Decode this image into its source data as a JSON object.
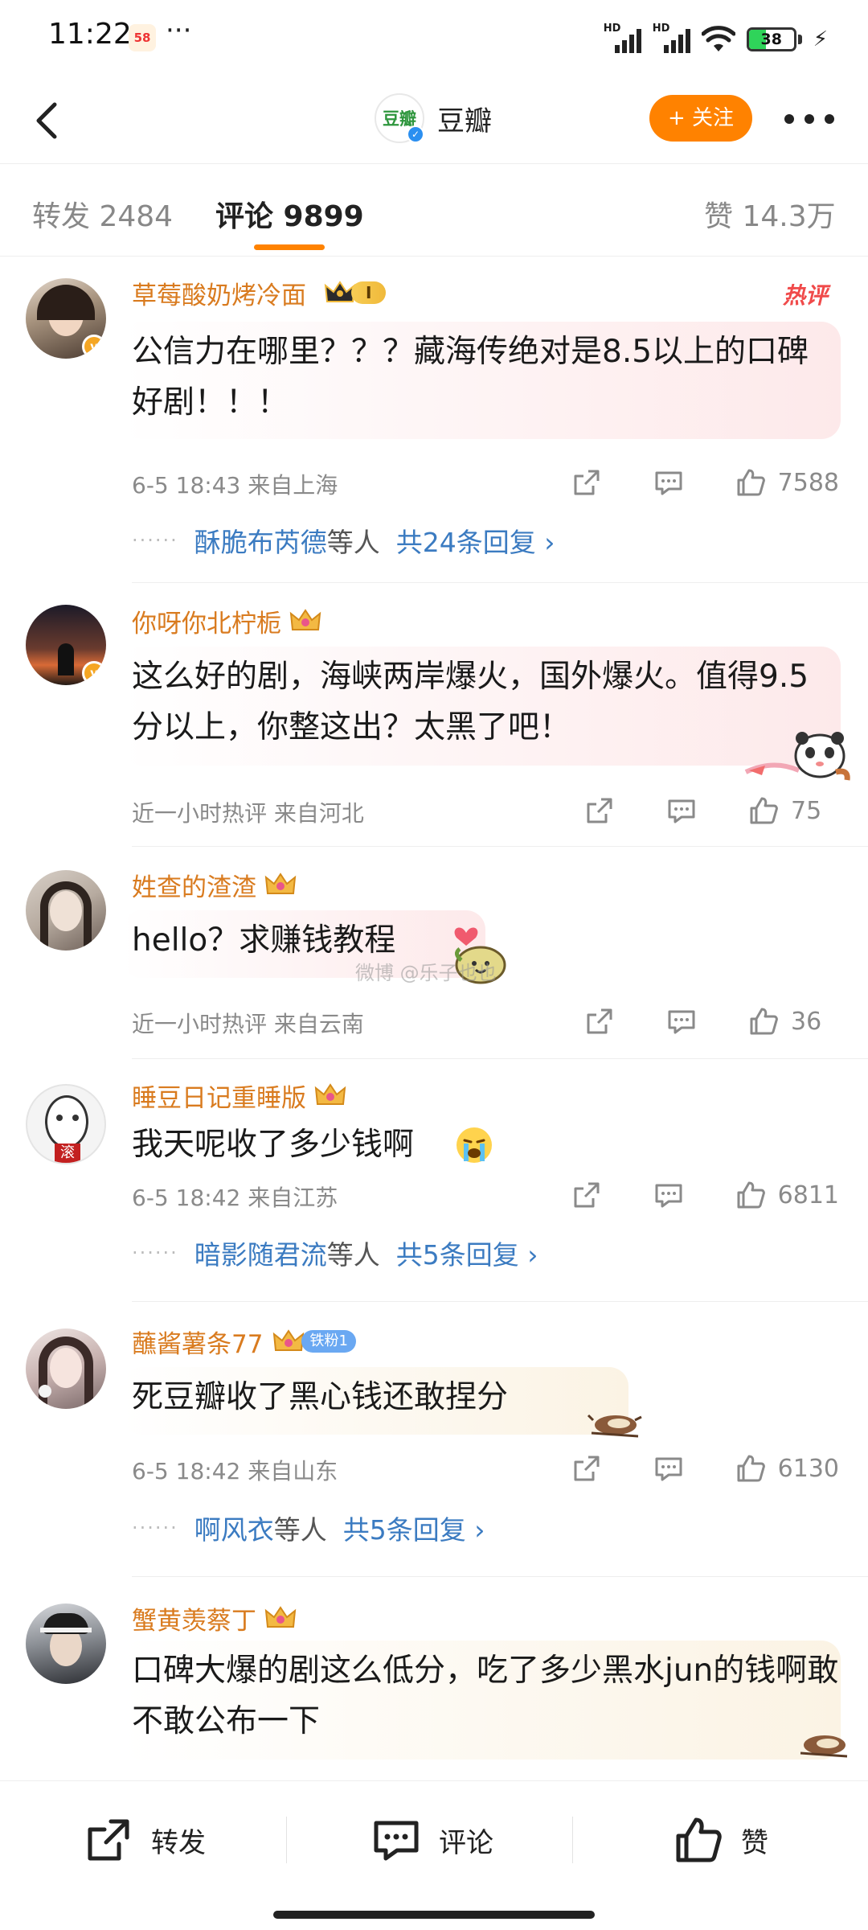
{
  "status_bar": {
    "time": "11:22",
    "app_badge": "58",
    "more": "···",
    "signal1": "HD",
    "signal2": "HD",
    "battery": "38",
    "battery_level": 0.38
  },
  "header": {
    "brand_logo_text": "豆瓣",
    "brand_name": "豆瓣",
    "follow_label": "+ 关注"
  },
  "tabs": {
    "repost": "转发 2484",
    "comments": "评论 9899",
    "likes": "赞 14.3万"
  },
  "comments": [
    {
      "name": "草莓酸奶烤冷面",
      "badge_level": "I",
      "hot_tag": "热评",
      "text": "公信力在哪里？？？藏海传绝对是8.5以上的口碑好剧！！！",
      "meta": "6-5 18:43  来自上海",
      "likes": "7588",
      "reply_user": "酥脆布芮德",
      "reply_etc": "等人",
      "reply_total": "共24条回复 ›"
    },
    {
      "name": "你呀你北柠栀",
      "text": "这么好的剧，海峡两岸爆火，国外爆火。值得9.5分以上，你整这出？太黑了吧！",
      "meta": "近一小时热评  来自河北",
      "likes": "75"
    },
    {
      "name": "姓查的渣渣",
      "text": "hello？求赚钱教程",
      "watermark": "微博 @乐子也也",
      "meta": "近一小时热评  来自云南",
      "likes": "36"
    },
    {
      "name": "睡豆日记重睡版",
      "text": "我天呢收了多少钱啊",
      "meta": "6-5 18:42  来自江苏",
      "likes": "6811",
      "reply_user": "暗影随君流",
      "reply_etc": "等人",
      "reply_total": "共5条回复 ›"
    },
    {
      "name": "蘸酱薯条77",
      "fan_badge": "铁粉1",
      "text": "死豆瓣收了黑心钱还敢捏分",
      "meta": "6-5 18:42  来自山东",
      "likes": "6130",
      "reply_user": "啊风衣",
      "reply_etc": "等人",
      "reply_total": "共5条回复 ›"
    },
    {
      "name": "蟹黄羡蔡丁",
      "text": "口碑大爆的剧这么低分，吃了多少黑水jun的钱啊敢不敢公布一下"
    }
  ],
  "bottom_bar": {
    "repost": "转发",
    "comment": "评论",
    "like": "赞"
  },
  "colors": {
    "accent_orange": "#ff8200",
    "username": "#d97b1f",
    "reply_link": "#3b7bc1",
    "hot_red": "#f04a4a"
  }
}
